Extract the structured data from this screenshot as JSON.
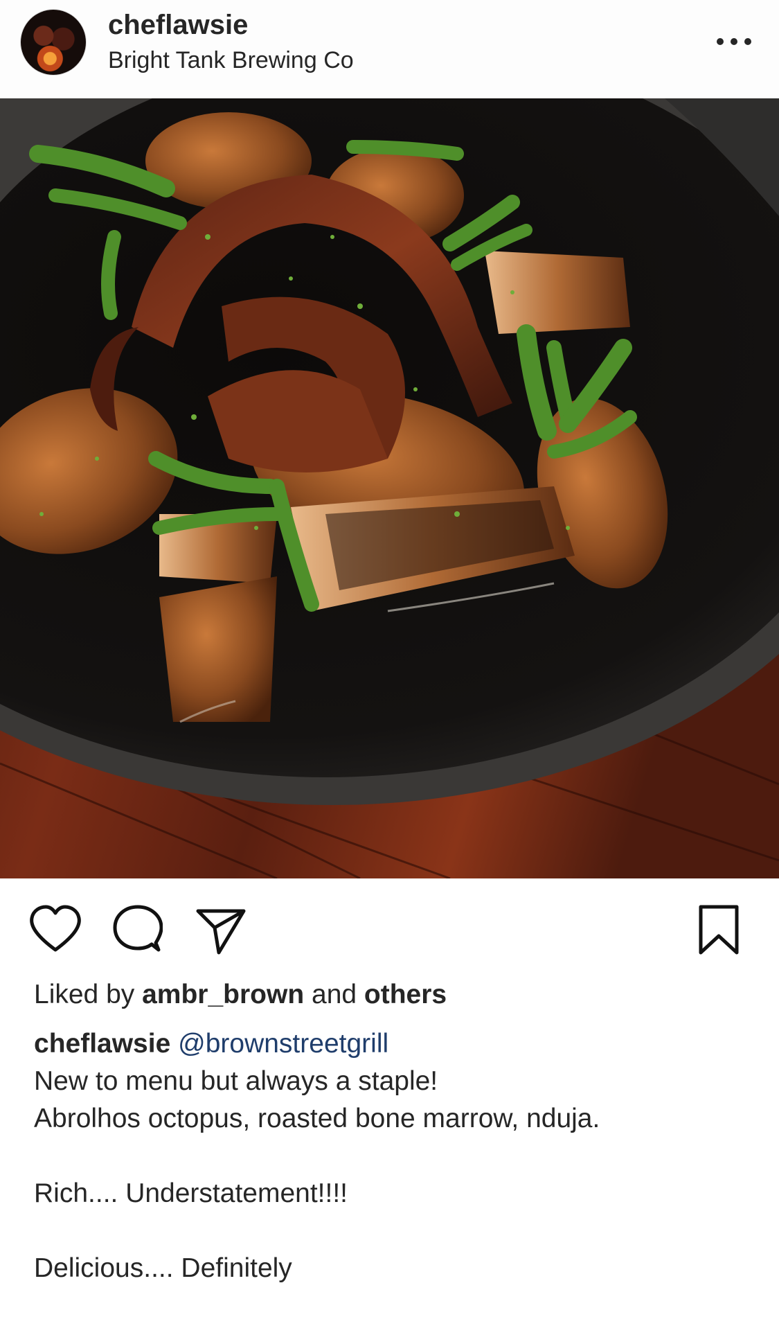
{
  "post": {
    "username": "cheflawsie",
    "location": "Bright Tank Brewing Co",
    "likes": {
      "prefix": "Liked by",
      "user": "ambr_brown",
      "middle": "and",
      "others": "others"
    },
    "caption": {
      "username": "cheflawsie",
      "mention": "@brownstreetgrill",
      "lines": [
        "New to menu but always a staple!",
        "Abrolhos octopus, roasted bone marrow, nduja.",
        "",
        "Rich.... Understatement!!!!",
        "",
        "Delicious.... Definitely"
      ]
    }
  },
  "icons": {
    "more": "more-options-icon",
    "like": "heart-icon",
    "comment": "comment-bubble-icon",
    "share": "paper-plane-icon",
    "save": "bookmark-icon"
  },
  "colors": {
    "text": "#262626",
    "mention": "#1f3d6b",
    "background": "#ffffff"
  }
}
